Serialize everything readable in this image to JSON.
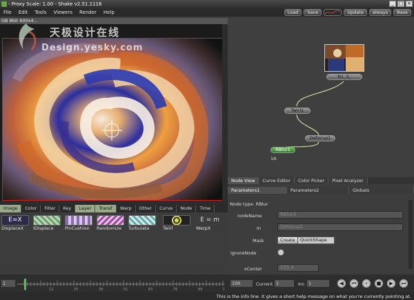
{
  "window": {
    "title": "- Proxy Scale: 1.00 - Shake v2.51.1116",
    "controls": [
      "_",
      "□",
      "×"
    ]
  },
  "menu": [
    "File",
    "Edit",
    "Tools",
    "Viewers",
    "Render",
    "Help"
  ],
  "toolbar_right": {
    "load": "Load",
    "save": "Save",
    "update": "Update",
    "always": "always",
    "base": "Base"
  },
  "viewer": {
    "header": "GB 8bit 600x4..."
  },
  "watermark": {
    "cn": "天极设计在线",
    "en": "Design.yesky.com"
  },
  "nodes": {
    "file_node": "N1_3_",
    "twirl": "Twirl1",
    "defocus": "Defocus1",
    "rblur": "RBlur1",
    "rblur_sub": "1A"
  },
  "view_tabs": [
    "Node View",
    "Curve Editor",
    "Color Picker",
    "Pixel Analyzer"
  ],
  "param_tabs": [
    "Parameters1",
    "Parameters2",
    "Globals"
  ],
  "parameters": {
    "node_type": "Node type: RBlur",
    "nodeName_label": "nodeName",
    "nodeName_value": "RBlur1",
    "in_label": "In",
    "in_value": "Defocus1",
    "mask_label": "Mask",
    "create_label": "Create",
    "mask_type": "QuickShape",
    "ignore_label": "ignoreNode",
    "xcenter_label": "xCenter",
    "xcenter_value": "325.4"
  },
  "tool_tabs": [
    "Image",
    "Color",
    "Filter",
    "Key",
    "Layer",
    "Transf",
    "Warp",
    "Other",
    "Curve",
    "Node",
    "Time"
  ],
  "tools": [
    {
      "label": "DisplaceX"
    },
    {
      "label": "IDisplace"
    },
    {
      "label": "PinCushion"
    },
    {
      "label": "Randomize"
    },
    {
      "label": "Turbulate"
    },
    {
      "label": "Twirl"
    },
    {
      "label": "WarpX"
    }
  ],
  "timeline": {
    "start": "1",
    "end": "100",
    "current_label": "Current",
    "current_value": "1",
    "inc_label": "Inc",
    "inc_value": "1",
    "ticks": [
      "1",
      "12",
      "25",
      "38",
      "51",
      "63",
      "76",
      "89",
      "100"
    ]
  },
  "info": "This is the info line. It gives a short help message on what you're currently pointing at."
}
